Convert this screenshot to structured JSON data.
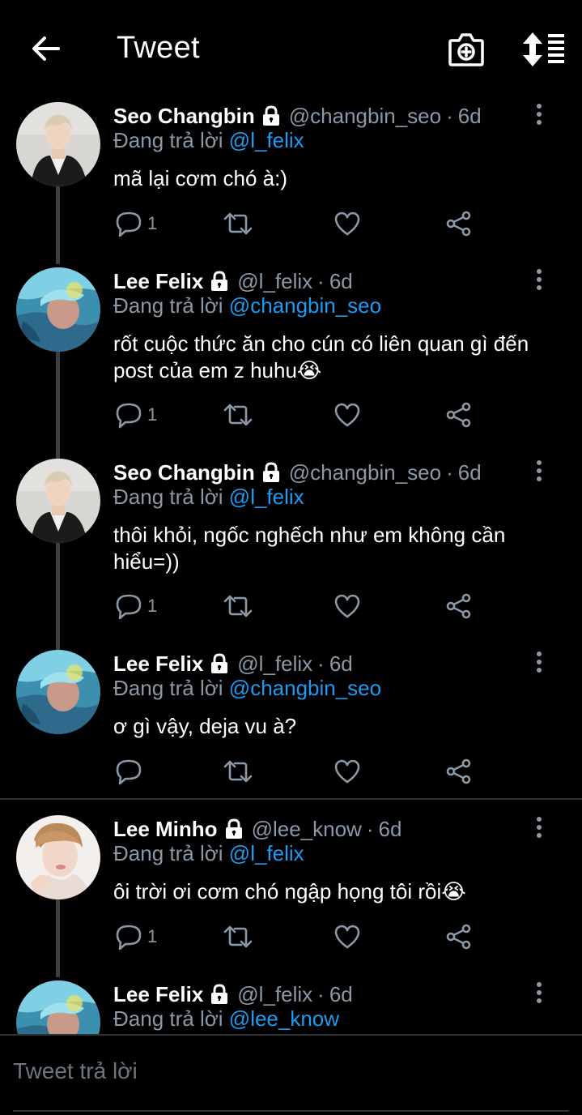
{
  "header": {
    "title": "Tweet"
  },
  "icons": {
    "back": "arrow-left-icon",
    "camera": "camera-add-icon",
    "sort": "sort-icon"
  },
  "colors": {
    "background": "#000000",
    "secondary_text": "#8b98a5",
    "mention": "#1d9bf0",
    "divider": "#2f3336"
  },
  "reply_prefix": "Đang trả lời",
  "tweets": [
    {
      "name": "Seo Changbin",
      "handle": "@changbin_seo",
      "dot": "·",
      "time": "6d",
      "reply_to": "@l_felix",
      "text": "mã lại cơm chó à:)",
      "reply_count": "1"
    },
    {
      "name": "Lee Felix",
      "handle": "@l_felix",
      "dot": "·",
      "time": "6d",
      "reply_to": "@changbin_seo",
      "text": "rốt cuộc thức ăn cho cún có liên quan gì đến post của em z huhu😭",
      "reply_count": "1"
    },
    {
      "name": "Seo Changbin",
      "handle": "@changbin_seo",
      "dot": "·",
      "time": "6d",
      "reply_to": "@l_felix",
      "text": "thôi khỏi, ngốc nghếch như em không cần hiểu=))",
      "reply_count": "1"
    },
    {
      "name": "Lee Felix",
      "handle": "@l_felix",
      "dot": "·",
      "time": "6d",
      "reply_to": "@changbin_seo",
      "text": "ơ gì vậy, deja vu à?",
      "reply_count": ""
    },
    {
      "name": "Lee Minho",
      "handle": "@lee_know",
      "dot": "·",
      "time": "6d",
      "reply_to": "@l_felix",
      "text": "ôi trời ơi cơm chó ngập họng tôi rồi😭",
      "reply_count": "1"
    },
    {
      "name": "Lee Felix",
      "handle": "@l_felix",
      "dot": "·",
      "time": "6d",
      "reply_to": "@lee_know",
      "text": "",
      "reply_count": ""
    }
  ],
  "reply_bar": {
    "placeholder": "Tweet trả lời"
  }
}
